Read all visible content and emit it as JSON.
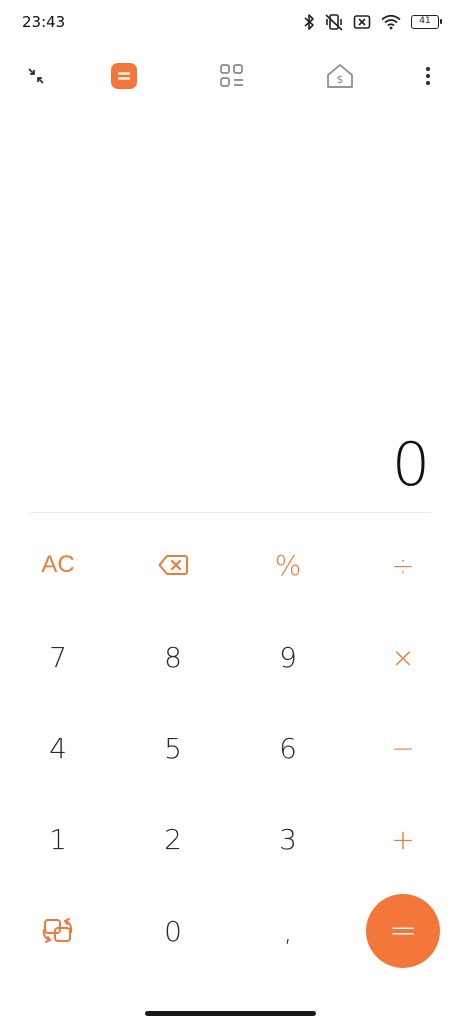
{
  "status_bar": {
    "time": "23:43",
    "battery_level": "41",
    "icons": [
      "bluetooth-icon",
      "vibrate-off-icon",
      "sim-off-icon",
      "wifi-icon",
      "battery-icon"
    ]
  },
  "toolbar": {
    "items": [
      {
        "name": "collapse-icon",
        "active": false
      },
      {
        "name": "calculator-icon",
        "active": true
      },
      {
        "name": "converter-grid-icon",
        "active": false
      },
      {
        "name": "currency-house-icon",
        "active": false
      },
      {
        "name": "more-vert-icon",
        "active": false
      }
    ]
  },
  "display": {
    "value": "0"
  },
  "keypad": {
    "row1": {
      "clear": "AC",
      "backspace_icon": "backspace-icon",
      "percent": "%",
      "divide": "÷"
    },
    "row2": {
      "k7": "7",
      "k8": "8",
      "k9": "9",
      "multiply": "×"
    },
    "row3": {
      "k4": "4",
      "k5": "5",
      "k6": "6",
      "minus": "−"
    },
    "row4": {
      "k1": "1",
      "k2": "2",
      "k3": "3",
      "plus": "+"
    },
    "row5": {
      "switch_icon": "switch-mode-icon",
      "k0": "0",
      "decimal": ",",
      "equals": "="
    }
  },
  "colors": {
    "accent": "#f3773a",
    "text": "#2b2b2b",
    "background": "#ffffff"
  }
}
